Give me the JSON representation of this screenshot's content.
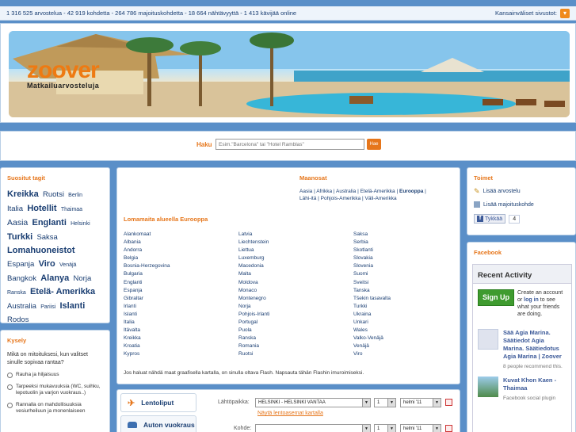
{
  "topbar": {
    "stats": "1 316 525 arvostelua - 42 919 kohdetta - 264 786 majoituskohdetta - 18 664 nähtävyyttä - 1 413 kävijää online",
    "intl_label": "Kansainväliset sivustot:"
  },
  "logo": {
    "brand": "zoover",
    "tagline": "Matkailuarvosteluja"
  },
  "search": {
    "label": "Haku",
    "placeholder": "Esim.\"Barcelona\" tai \"Hotel Ramblas\"",
    "button": "Hae"
  },
  "tags": {
    "title": "Suositut tagit",
    "items": [
      {
        "text": "Kreikka",
        "size": "t-xl"
      },
      {
        "text": "Ruotsi",
        "size": "t-m"
      },
      {
        "text": "Berlin",
        "size": "t-s"
      },
      {
        "text": "Italia",
        "size": "t-m"
      },
      {
        "text": "Hotellit",
        "size": "t-xl"
      },
      {
        "text": "Thaimaa",
        "size": "t-s"
      },
      {
        "text": "Aasia",
        "size": "t-l"
      },
      {
        "text": "Englanti",
        "size": "t-xl"
      },
      {
        "text": "Helsinki",
        "size": "t-s"
      },
      {
        "text": "Turkki",
        "size": "t-xl"
      },
      {
        "text": "Saksa",
        "size": "t-m"
      },
      {
        "text": "Lomahuoneistot",
        "size": "t-xl"
      },
      {
        "text": "Espanja",
        "size": "t-m"
      },
      {
        "text": "Viro",
        "size": "t-xl"
      },
      {
        "text": "Venäjä",
        "size": "t-s"
      },
      {
        "text": "Bangkok",
        "size": "t-m"
      },
      {
        "text": "Alanya",
        "size": "t-xl"
      },
      {
        "text": "Norja",
        "size": "t-m"
      },
      {
        "text": "Ranska",
        "size": "t-s"
      },
      {
        "text": "Etelä- Amerikka",
        "size": "t-xl"
      },
      {
        "text": "Australia",
        "size": "t-m"
      },
      {
        "text": "Pariisi",
        "size": "t-s"
      },
      {
        "text": "Islanti",
        "size": "t-xl"
      },
      {
        "text": "Rodos",
        "size": "t-m"
      }
    ]
  },
  "poll": {
    "title": "Kysely",
    "question": "Mikä on mitoituksesi, kun valitset sinulle sopivaa rantaa?",
    "options": [
      "Rauha ja hiljaisuus",
      "Tarpeeksi mukavuuksia (WC, suihku, lepotuolin ja varjon vuokraus..)",
      "Rannalla on mahdollisuuksia vesiurheiluun ja monenlaiseen"
    ]
  },
  "continents": {
    "title": "Maanosat",
    "line1": "Aasia | Afrikka | Australia | Etelä-Amerikka |",
    "bold": "Eurooppa",
    "line1_end": "|",
    "line2": "Lähi-itä | Pohjois-Amerikka | Väli-Amerikka"
  },
  "popular": {
    "title": "Lomamaita alueella Eurooppa",
    "col1": [
      "Alankomaat",
      "Albania",
      "Andorra",
      "Belgia",
      "Bosnia-Herzegovina",
      "Bulgaria",
      "Englanti",
      "Espanja",
      "Gibraltar",
      "Irlanti",
      "Islanti",
      "Italia",
      "Itävalta",
      "Kreikka",
      "Kroatia",
      "Kypros"
    ],
    "col2": [
      "Latvia",
      "Liechtenstein",
      "Liettua",
      "Luxemburg",
      "Macedonia",
      "Malta",
      "Moldova",
      "Monaco",
      "Montenegro",
      "Norja",
      "Pohjois-Irlanti",
      "Portugal",
      "Puola",
      "Ranska",
      "Romania",
      "Ruotsi"
    ],
    "col3": [
      "Saksa",
      "Serbia",
      "Skotlanti",
      "Slovakia",
      "Slovenia",
      "Suomi",
      "Sveitsi",
      "Tanska",
      "Tšekin tasavalta",
      "Turkki",
      "Ukraina",
      "Unkari",
      "Wales",
      "Valko-Venäjä",
      "Venäjä",
      "Viro"
    ]
  },
  "flash_note": "Jos haluat nähdä maat graafisella kartalla, on sinulla oltava Flash. Napsauta tähän Flashin imuroimiseksi.",
  "booking": {
    "tabs": [
      "Lentoliput",
      "Auton vuokraus"
    ],
    "departure_label": "Lähtöpaikka:",
    "departure_value": "HELSINKI - HELSINKI VANTAA",
    "day_value": "1",
    "month_value": "helmi '11",
    "airports_link": "Näytä lentoasemat kartalla",
    "destination_label": "Kohde:",
    "destination_value": ""
  },
  "toimet": {
    "title": "Toimet",
    "actions": [
      "Lisää arvostelu",
      "Lisää majoituskohde"
    ],
    "like_label": "Tykkää",
    "like_count": "4"
  },
  "facebook": {
    "title": "Facebook",
    "box_title": "Recent Activity",
    "signup_button": "Sign Up",
    "signup_pre": "Create an account or ",
    "signup_login": "log in",
    "signup_post": " to see what your friends are doing.",
    "items": [
      {
        "title": "Sää Agia Marina. Säätiedot Agia Marina. Säätiedotus Agia Marina | Zoover",
        "meta": "8 people recommend this."
      },
      {
        "title": "Kuvat Khon Kaen - Thaimaa",
        "meta": "Facebook social plugin"
      }
    ]
  },
  "colors": {
    "accent": "#e6761b",
    "link": "#1a3e72",
    "background": "#5a8fc8"
  }
}
